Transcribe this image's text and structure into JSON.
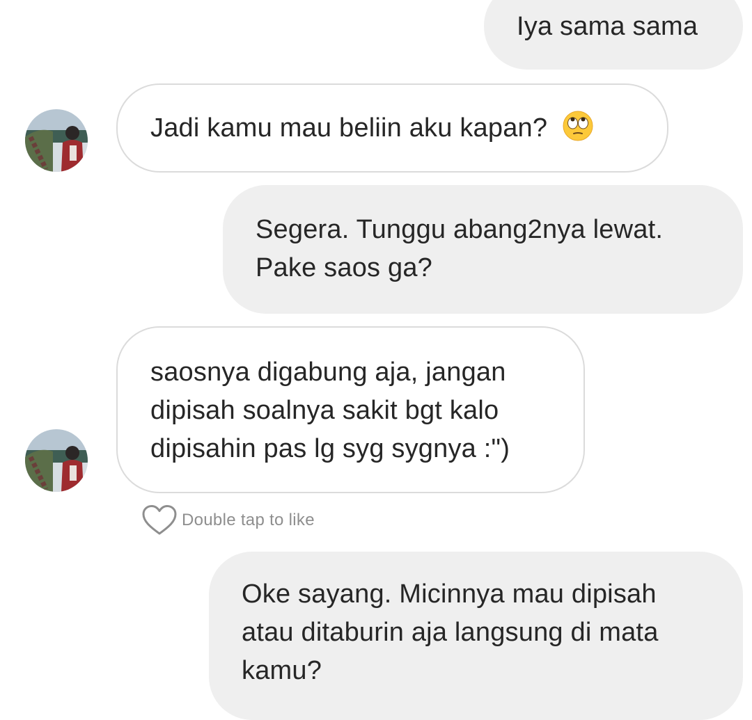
{
  "messages": [
    {
      "side": "sent",
      "lines": [
        "Iya sama sama"
      ]
    },
    {
      "side": "received",
      "lines": [
        "Jadi kamu mau beliin aku kapan?"
      ],
      "emoji": "face-with-rolling-eyes"
    },
    {
      "side": "sent",
      "lines": [
        "Segera. Tunggu abang2nya lewat.",
        "Pake saos ga?"
      ]
    },
    {
      "side": "received",
      "lines": [
        "saosnya digabung aja,  jangan",
        "dipisah soalnya sakit bgt kalo",
        "dipisahin pas lg syg sygnya :\")"
      ]
    },
    {
      "side": "sent",
      "lines": [
        "Oke sayang. Micinnya mau dipisah",
        "atau ditaburin aja langsung di mata",
        "kamu?"
      ]
    }
  ],
  "like": {
    "label": "Double tap to like",
    "icon": "heart-outline-icon"
  },
  "colors": {
    "sent_bubble": "#efefef",
    "received_border": "#dbdbdb",
    "text": "#262626",
    "hint": "#8e8e8e"
  }
}
